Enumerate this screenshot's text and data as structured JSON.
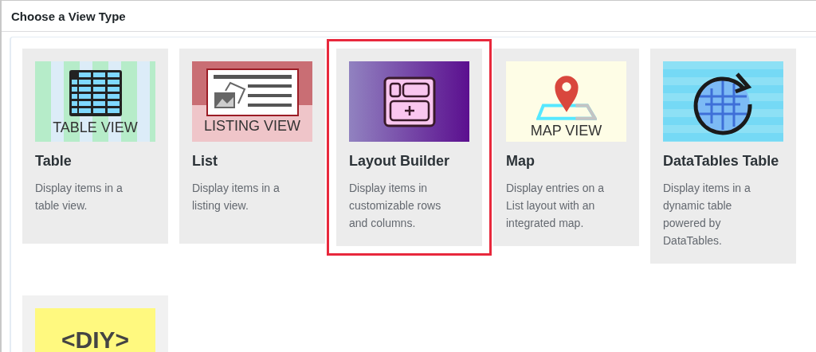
{
  "header": {
    "title": "Choose a View Type"
  },
  "view_types": [
    {
      "kind": "table",
      "caption": "TABLE VIEW",
      "title": "Table",
      "description": "Display items in a table view.",
      "selected": false
    },
    {
      "kind": "listing",
      "caption": "LISTING VIEW",
      "title": "List",
      "description": "Display items in a listing view.",
      "selected": false
    },
    {
      "kind": "layout",
      "title": "Layout Builder",
      "description": "Display items in customizable rows and columns.",
      "selected": true
    },
    {
      "kind": "map",
      "caption": "MAP VIEW",
      "title": "Map",
      "description": "Display entries on a List layout with an integrated map.",
      "selected": false
    },
    {
      "kind": "datatables",
      "title": "DataTables Table",
      "description": "Display items in a dynamic table powered by DataTables.",
      "selected": false
    },
    {
      "kind": "diy",
      "caption": "<DIY>",
      "selected": false
    }
  ]
}
